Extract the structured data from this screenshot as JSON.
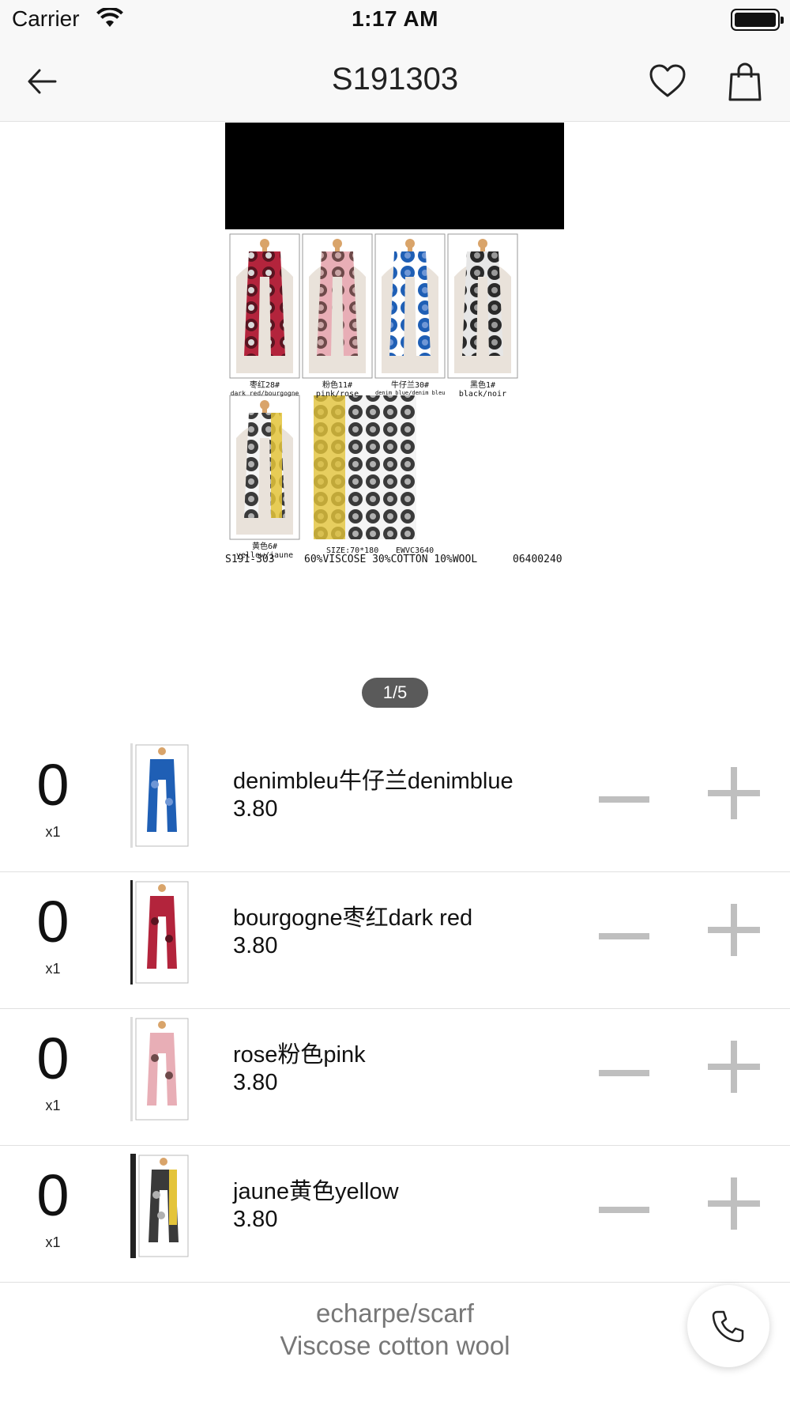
{
  "status_bar": {
    "carrier": "Carrier",
    "time": "1:17 AM"
  },
  "nav": {
    "title": "S191303",
    "back_icon": "arrow-left-icon",
    "favorite_icon": "heart-icon",
    "cart_icon": "shopping-bag-icon"
  },
  "gallery": {
    "page_indicator": "1/5",
    "tags": [
      {
        "cn": "枣红28#",
        "label": "dark red/bourgogne"
      },
      {
        "cn": "粉色11#",
        "label": "pink/rose"
      },
      {
        "cn": "牛仔兰30#",
        "label": "denim blue/denim bleu"
      },
      {
        "cn": "黑色1#",
        "label": "black/noir"
      },
      {
        "cn": "黄色6#",
        "label": "yellow/jaune"
      }
    ],
    "size_text": "SIZE:70*180",
    "code_text": "EWVC3640",
    "sku_text": "S191-303",
    "composition_text": "60%VISCOSE 30%COTTON 10%WOOL",
    "ref_text": "06400240",
    "colors": {
      "dark_red": "#b3243c",
      "pink": "#e8aeb6",
      "blue": "#1f5fb5",
      "black": "#2a2a2a",
      "yellow": "#e4c43a"
    }
  },
  "variants": [
    {
      "qty": "0",
      "mult": "x1",
      "name": "denimbleu牛仔兰denimblue",
      "price": "3.80",
      "color": "#1f5fb5",
      "caption": "牛仔兰30#"
    },
    {
      "qty": "0",
      "mult": "x1",
      "name": "bourgogne枣红dark red",
      "price": "3.80",
      "color": "#b3243c",
      "caption": "枣红28#"
    },
    {
      "qty": "0",
      "mult": "x1",
      "name": "rose粉色pink",
      "price": "3.80",
      "color": "#e8aeb6",
      "caption": "粉色11#"
    },
    {
      "qty": "0",
      "mult": "x1",
      "name": "jaune黄色yellow",
      "price": "3.80",
      "color": "#e4c43a",
      "caption": "黄色6#"
    }
  ],
  "description": {
    "line1": "echarpe/scarf",
    "line2": "Viscose cotton wool"
  },
  "call_icon": "phone-icon"
}
